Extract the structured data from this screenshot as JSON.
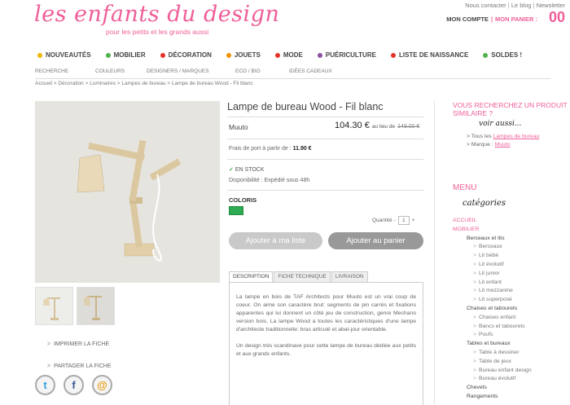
{
  "header": {
    "logo_text": "les enfants du design",
    "tagline": "pour les petits et les grands aussi",
    "top_links": [
      "Nous contacter",
      "Le blog",
      "Newsletter"
    ],
    "account_label": "MON COMPTE",
    "cart_label": "MON PANIER :",
    "cart_count": "00"
  },
  "main_nav": [
    {
      "label": "NOUVEAUTÉS",
      "color": "#f0b500"
    },
    {
      "label": "MOBILIER",
      "color": "#4fb24e"
    },
    {
      "label": "DÉCORATION",
      "color": "#e6332a"
    },
    {
      "label": "JOUETS",
      "color": "#f39200"
    },
    {
      "label": "MODE",
      "color": "#e6332a"
    },
    {
      "label": "PUÉRICULTURE",
      "color": "#8e4f9e"
    },
    {
      "label": "LISTE DE NAISSANCE",
      "color": "#e6332a"
    },
    {
      "label": "SOLDES !",
      "color": "#4fb24e"
    }
  ],
  "sub_nav": [
    "RECHERCHE",
    "COULEURS",
    "DESIGNERS / MARQUES",
    "ECO / BIO",
    "IDÉES CADEAUX"
  ],
  "breadcrumb": "Accueil > Décoration > Luminaires > Lampes de bureau > Lampe de bureau Wood - Fil blanc",
  "product": {
    "title": "Lampe de bureau Wood - Fil blanc",
    "brand": "Muuto",
    "price": "104.30 €",
    "price_note": "au lieu de",
    "old_price": "149.00 €",
    "shipping_label": "Frais de port à partir de :",
    "shipping_value": "11.90 €",
    "stock": "EN STOCK",
    "availability": "Disponibilité : Expédié sous 48h",
    "coloris_label": "COLORIS",
    "swatch_color": "#2eaa52",
    "quantity_label": "Quantité",
    "quantity_minus": "-",
    "quantity_value": "1",
    "quantity_plus": "+",
    "add_to_list": "Ajouter à ma liste",
    "add_to_cart": "Ajouter au panier"
  },
  "tabs": [
    "DESCRIPTION",
    "FICHE TECHNIQUE",
    "LIVRAISON"
  ],
  "description": [
    "La lampe en bois de TAF Architects pour Muuto est un vrai coup de coeur. On aime son caractère brut: segments de pin carrés et fixations apparentes qui lui donnent un côté jeu de construction, genre Mechano version bois. La lampe Wood a toutes les caractéristiques d'une lampe d'architecte traditionnelle: bras articulé et abat-jour orientable.",
    "Un design très scandinave pour cette lampe de bureau dédiée aux petits et aux grands enfants."
  ],
  "left_links": {
    "print": "IMPRIMER LA FICHE",
    "share": "PARTAGER LA FICHE"
  },
  "social_icons": [
    "twitter-icon",
    "facebook-icon",
    "email-icon"
  ],
  "right_col": {
    "similar_heading": "VOUS RECHERCHEZ UN PRODUIT SIMILAIRE ?",
    "voir_aussi": "voir aussi...",
    "see_all_prefix": "Tous les",
    "see_all_link": "Lampes de bureau",
    "brand_prefix": "Marque :",
    "brand_link": "Muuto",
    "menu_heading": "MENU",
    "categories_script": "catégories",
    "tree": [
      {
        "level": 1,
        "label": "ACCUEIL"
      },
      {
        "level": 1,
        "label": "MOBILIER"
      },
      {
        "level": 2,
        "label": "Berceaux et lits"
      },
      {
        "level": 3,
        "label": "Berceaux"
      },
      {
        "level": 3,
        "label": "Lit bébé"
      },
      {
        "level": 3,
        "label": "Lit évolutif"
      },
      {
        "level": 3,
        "label": "Lit junior"
      },
      {
        "level": 3,
        "label": "Lit enfant"
      },
      {
        "level": 3,
        "label": "Lit mezzanine"
      },
      {
        "level": 3,
        "label": "Lit superposé"
      },
      {
        "level": 2,
        "label": "Chaises et tabourets"
      },
      {
        "level": 3,
        "label": "Chaises enfant"
      },
      {
        "level": 3,
        "label": "Bancs et tabourets"
      },
      {
        "level": 3,
        "label": "Poufs"
      },
      {
        "level": 2,
        "label": "Tables et bureaux"
      },
      {
        "level": 3,
        "label": "Table à dessiner"
      },
      {
        "level": 3,
        "label": "Table de jeux"
      },
      {
        "level": 3,
        "label": "Bureau enfant design"
      },
      {
        "level": 3,
        "label": "Bureau évolutif"
      },
      {
        "level": 2,
        "label": "Chevets"
      },
      {
        "level": 2,
        "label": "Rangements"
      }
    ]
  }
}
